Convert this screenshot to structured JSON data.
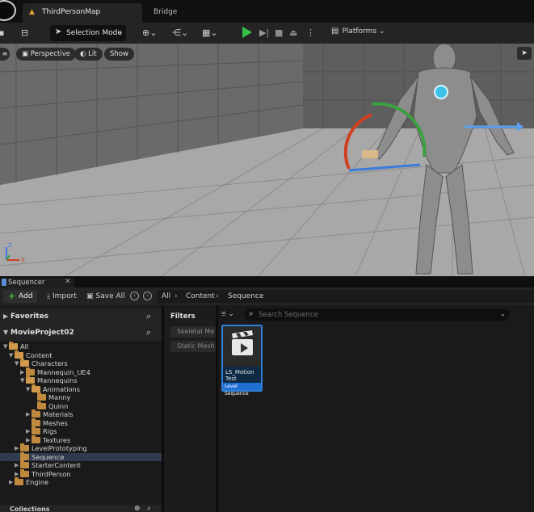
{
  "titlebar": {
    "map_tab": "ThirdPersonMap",
    "other_tab": "Bridge"
  },
  "toolbar": {
    "selection_mode": "Selection Mode",
    "platforms": "Platforms",
    "play_color": "#36c148"
  },
  "viewport": {
    "perspective": "Perspective",
    "lit": "Lit",
    "show": "Show",
    "axis_z": "Z",
    "axis_x": "X"
  },
  "sequencer_tab": {
    "label": "Sequencer",
    "close": "✕"
  },
  "content_toolbar": {
    "add": "Add",
    "import": "Import",
    "save_all": "Save All",
    "breadcrumb": [
      "All",
      "Content",
      "Sequence"
    ]
  },
  "left_panel": {
    "favorites": "Favorites",
    "project": "MovieProject02",
    "collections": "Collections",
    "tree": [
      {
        "label": "All",
        "depth": 0,
        "expanded": true,
        "has_children": true,
        "selected": false
      },
      {
        "label": "Content",
        "depth": 1,
        "expanded": true,
        "has_children": true,
        "selected": false
      },
      {
        "label": "Characters",
        "depth": 2,
        "expanded": true,
        "has_children": true,
        "selected": false
      },
      {
        "label": "Mannequin_UE4",
        "depth": 3,
        "expanded": false,
        "has_children": true,
        "selected": false
      },
      {
        "label": "Mannequins",
        "depth": 3,
        "expanded": true,
        "has_children": true,
        "selected": false
      },
      {
        "label": "Animations",
        "depth": 4,
        "expanded": true,
        "has_children": true,
        "selected": false
      },
      {
        "label": "Manny",
        "depth": 5,
        "expanded": false,
        "has_children": false,
        "selected": false
      },
      {
        "label": "Quinn",
        "depth": 5,
        "expanded": false,
        "has_children": false,
        "selected": false
      },
      {
        "label": "Materials",
        "depth": 4,
        "expanded": false,
        "has_children": true,
        "selected": false
      },
      {
        "label": "Meshes",
        "depth": 4,
        "expanded": false,
        "has_children": false,
        "selected": false
      },
      {
        "label": "Rigs",
        "depth": 4,
        "expanded": false,
        "has_children": true,
        "selected": false
      },
      {
        "label": "Textures",
        "depth": 4,
        "expanded": false,
        "has_children": true,
        "selected": false
      },
      {
        "label": "LevelPrototyping",
        "depth": 2,
        "expanded": false,
        "has_children": true,
        "selected": false
      },
      {
        "label": "Sequence",
        "depth": 2,
        "expanded": false,
        "has_children": false,
        "selected": true
      },
      {
        "label": "StarterContent",
        "depth": 2,
        "expanded": false,
        "has_children": true,
        "selected": false
      },
      {
        "label": "ThirdPerson",
        "depth": 2,
        "expanded": false,
        "has_children": true,
        "selected": false
      },
      {
        "label": "Engine",
        "depth": 1,
        "expanded": false,
        "has_children": true,
        "selected": false
      }
    ]
  },
  "filters": {
    "title": "Filters",
    "chips": [
      "Skeletal Me",
      "Static Mesh"
    ]
  },
  "assets": {
    "search_placeholder": "Search Sequence",
    "items": [
      {
        "name": "LS_Motion Test",
        "type": "Level Sequence"
      }
    ]
  }
}
